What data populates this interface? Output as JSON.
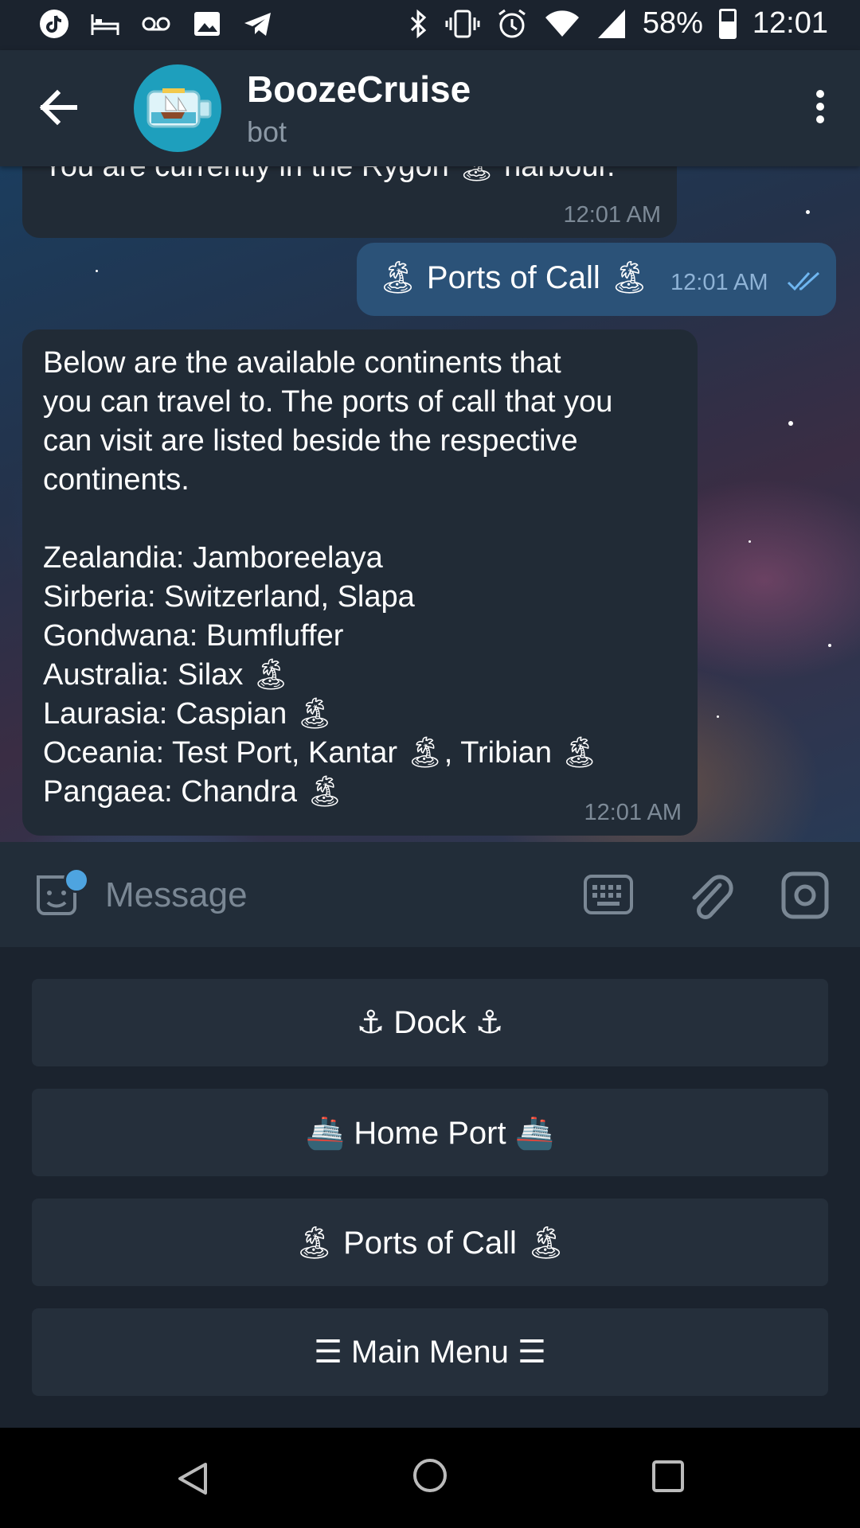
{
  "status_bar": {
    "battery": "58%",
    "time": "12:01",
    "left_icons": [
      "tiktok-icon",
      "bed-icon",
      "voicemail-icon",
      "image-icon",
      "telegram-icon"
    ],
    "right_icons": [
      "bluetooth-icon",
      "vibrate-icon",
      "alarm-icon",
      "wifi-icon",
      "signal-icon",
      "battery-icon"
    ]
  },
  "header": {
    "title": "BoozeCruise",
    "subtitle": "bot",
    "back_icon": "arrow-left-icon",
    "menu_icon": "more-vertical-icon"
  },
  "messages": [
    {
      "direction": "incoming",
      "text": "You are currently in the Rygon 🏝 harbour.",
      "time": "12:01 AM"
    },
    {
      "direction": "outgoing",
      "text": "🏝 Ports of Call 🏝",
      "time": "12:01 AM",
      "status": "read"
    },
    {
      "direction": "incoming",
      "text": "Below are the available continents that\nyou can travel to. The ports of call that you\ncan visit are listed beside the respective\ncontinents.\n\nZealandia: Jamboreelaya\nSirberia: Switzerland, Slapa\nGondwana: Bumfluffer\nAustralia: Silax 🏝\nLaurasia: Caspian 🏝\nOceania: Test Port, Kantar 🏝, Tribian 🏝\nPangaea: Chandra 🏝",
      "time": "12:01 AM"
    }
  ],
  "input": {
    "placeholder": "Message",
    "value": ""
  },
  "keyboard_buttons": [
    {
      "label": "⚓ Dock ⚓"
    },
    {
      "label": "🚢 Home Port 🚢"
    },
    {
      "label": "🏝 Ports of Call 🏝"
    },
    {
      "label": "☰ Main Menu ☰"
    }
  ],
  "colors": {
    "header_bg": "#222d39",
    "incoming_bubble": "#212b36",
    "outgoing_bubble": "#2b5278",
    "keyboard_button": "#252f3b",
    "accent": "#4ea4e0"
  }
}
